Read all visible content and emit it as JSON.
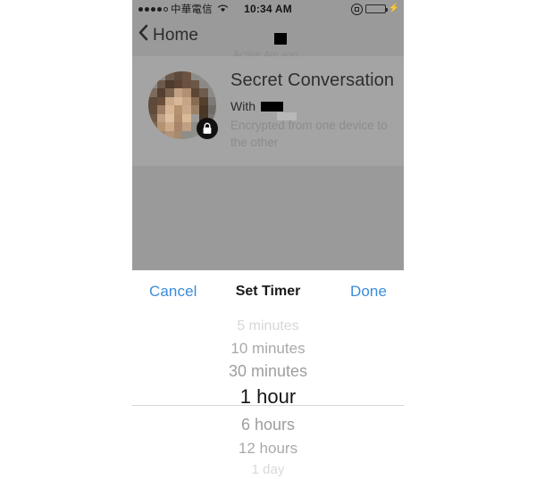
{
  "status_bar": {
    "signal_dots_filled": 4,
    "signal_dots_total": 5,
    "carrier": "中華電信",
    "time": "10:34 AM",
    "wifi_icon": "wifi-icon",
    "rotation_lock_icon": "rotation-lock-icon",
    "battery_icon": "battery-icon",
    "charging_icon": "⚡",
    "battery_color": "#4cd964"
  },
  "nav_bar": {
    "back_label": "Home",
    "back_icon": "chevron-left-icon",
    "redacted_title": "",
    "active_status": "Active 4m ago"
  },
  "conversation_card": {
    "title": "Secret Conversation",
    "with_label": "With",
    "with_name_redacted": "",
    "subtitle": "Encrypted from one device to the other",
    "avatar_name": "avatar",
    "lock_badge_icon": "lock-icon"
  },
  "sheet": {
    "toolbar": {
      "cancel_label": "Cancel",
      "title": "Set Timer",
      "done_label": "Done",
      "accent_color": "#3b8cd9"
    },
    "picker": {
      "selected_value": "1 hour",
      "options": [
        "5 minutes",
        "10 minutes",
        "30 minutes",
        "1 hour",
        "6 hours",
        "12 hours",
        "1 day"
      ]
    }
  },
  "colors": {
    "dim_overlay": "#9a9a9a",
    "card_background": "#a4a4a4",
    "sheet_background": "#ffffff",
    "selected_text": "#161616"
  }
}
